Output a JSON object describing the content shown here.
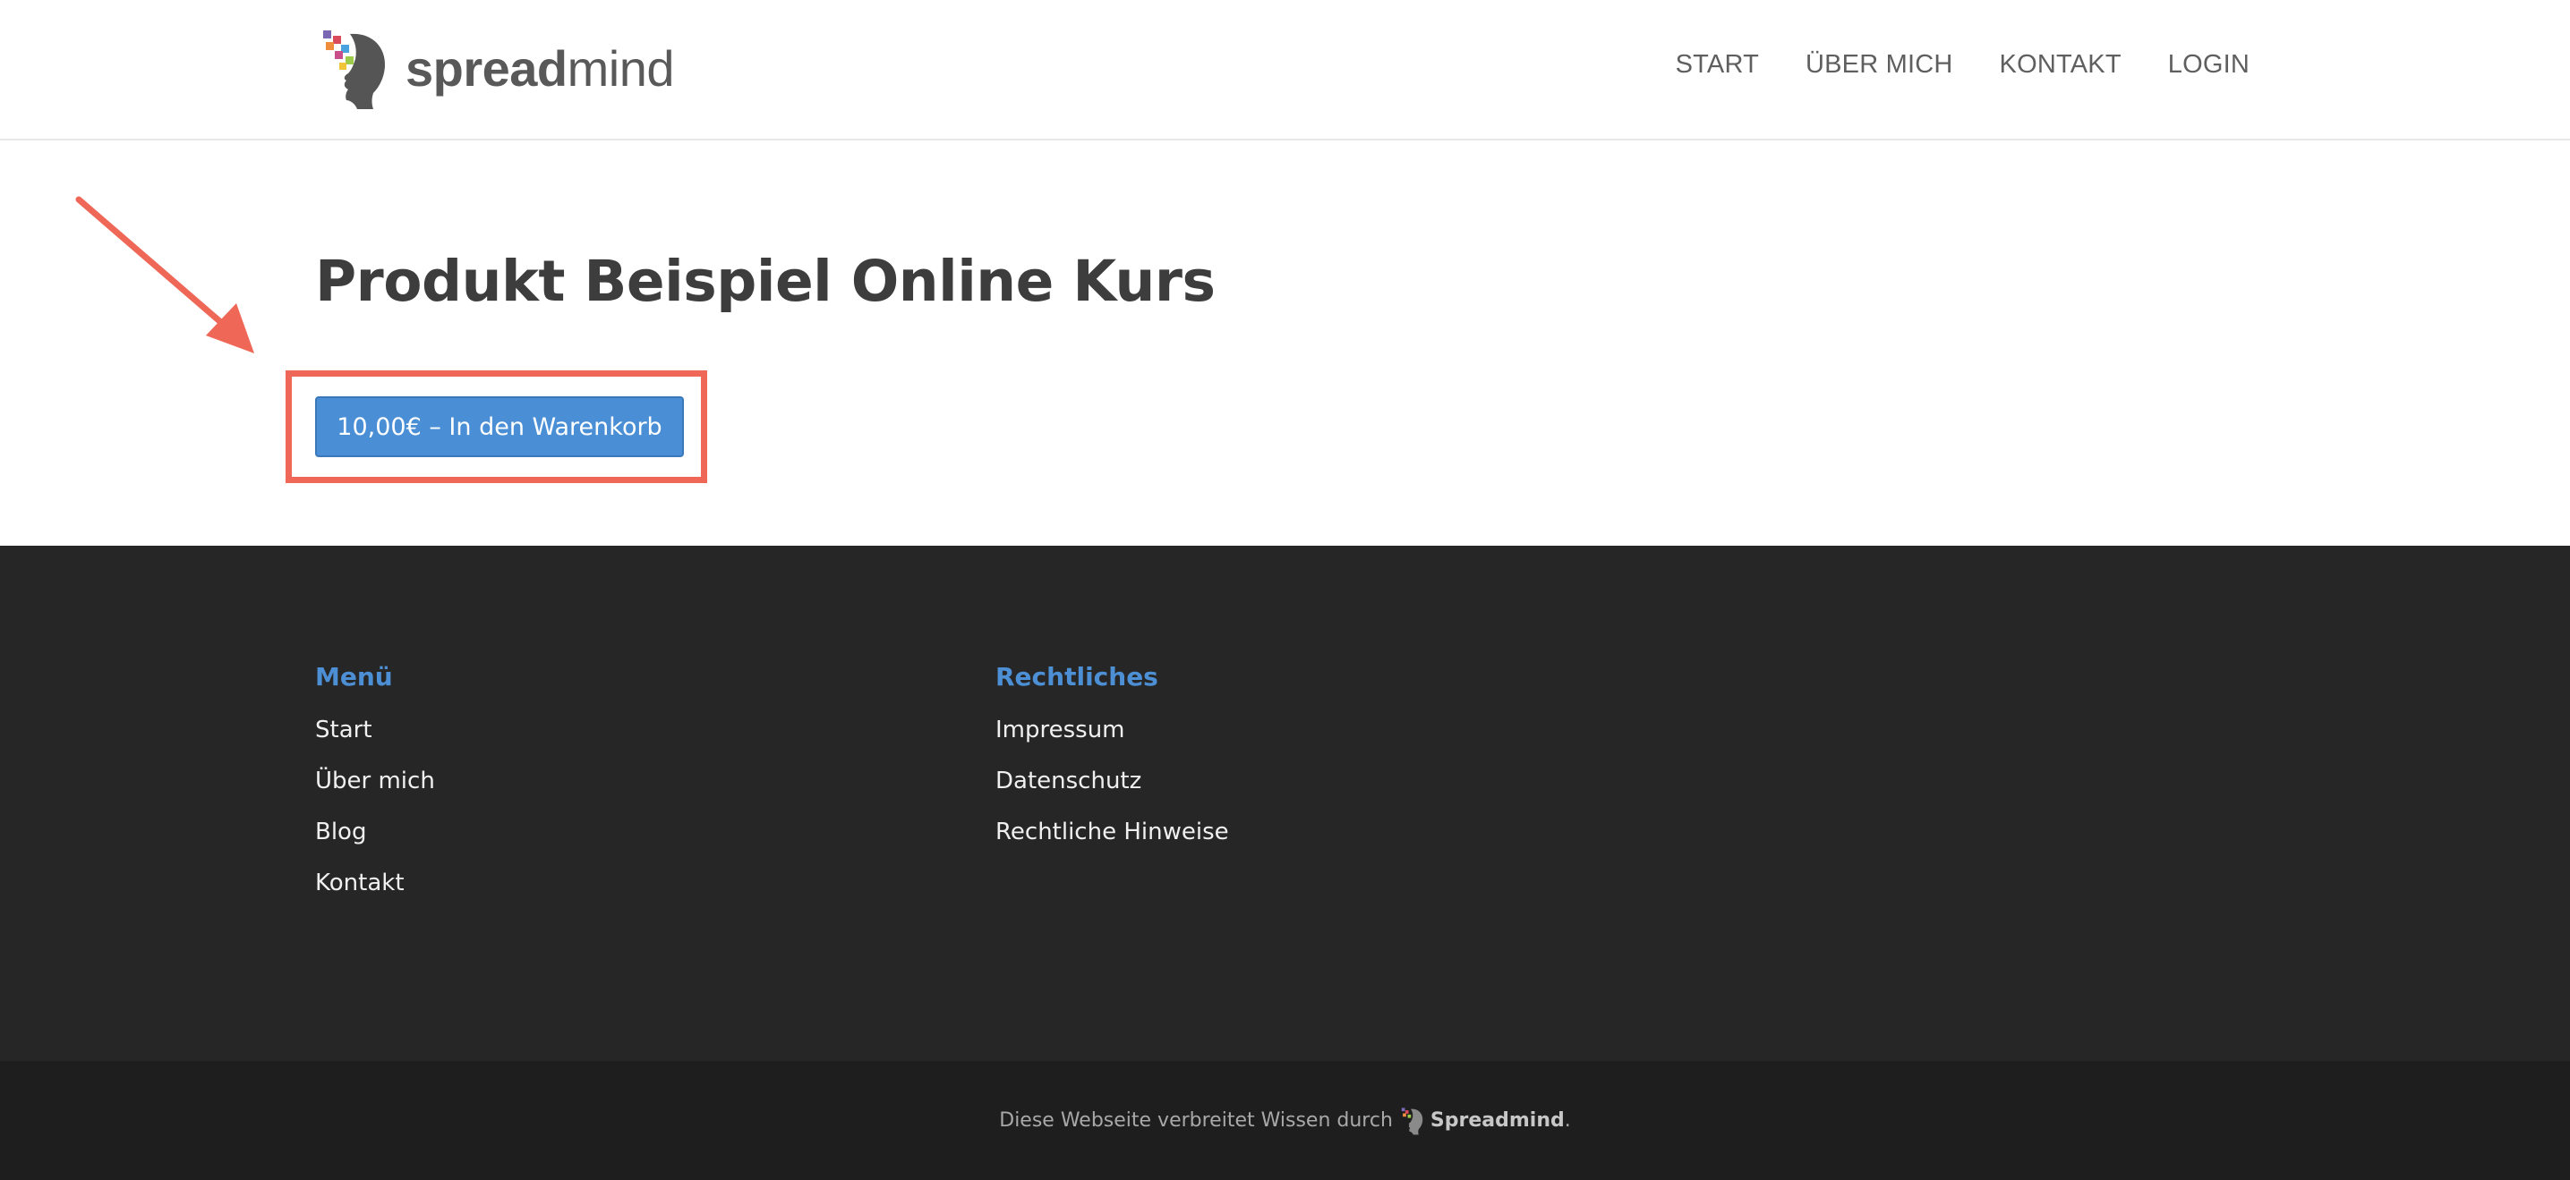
{
  "header": {
    "logo": {
      "icon": "spreadmind-head-logo-icon",
      "text_strong": "spread",
      "text_light": "mind"
    },
    "nav": [
      {
        "label": "START"
      },
      {
        "label": "ÜBER MICH"
      },
      {
        "label": "KONTAKT"
      },
      {
        "label": "LOGIN"
      }
    ]
  },
  "main": {
    "title": "Produkt Beispiel Online Kurs",
    "cart_button_label": "10,00€ – In den Warenkorb",
    "annotation": {
      "arrow_icon": "arrow-annotation-icon",
      "color": "#ee6757"
    }
  },
  "footer": {
    "menu": {
      "heading": "Menü",
      "items": [
        {
          "label": "Start"
        },
        {
          "label": "Über mich"
        },
        {
          "label": "Blog"
        },
        {
          "label": "Kontakt"
        }
      ]
    },
    "legal": {
      "heading": "Rechtliches",
      "items": [
        {
          "label": "Impressum"
        },
        {
          "label": "Datenschutz"
        },
        {
          "label": "Rechtliche Hinweise"
        }
      ]
    },
    "credit": {
      "text": "Diese Webseite verbreitet Wissen durch",
      "brand": "Spreadmind",
      "suffix": "."
    }
  },
  "colors": {
    "accent_blue": "#4a8fd6",
    "footer_heading_blue": "#4d8fd4",
    "footer_bg": "#262626",
    "bottom_bar_bg": "#1e1e1e",
    "highlight_red": "#ee6757"
  }
}
